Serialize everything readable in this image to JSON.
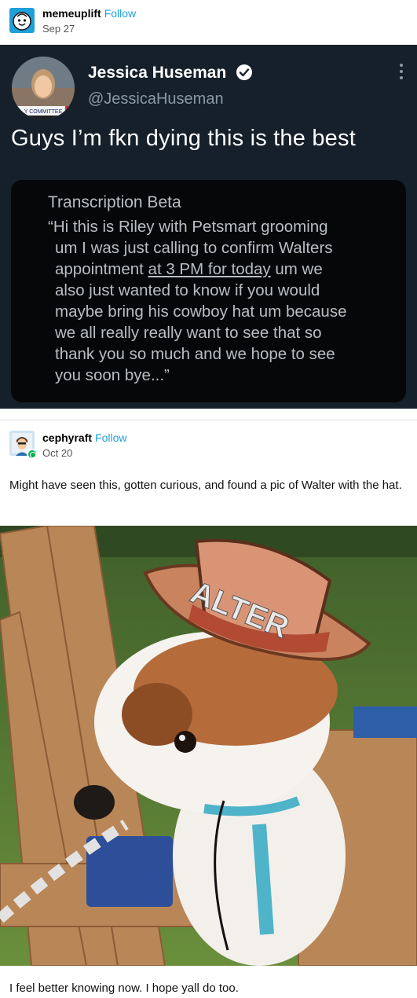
{
  "post1": {
    "username": "memeuplift",
    "follow_label": "Follow",
    "date": "Sep 27"
  },
  "tweet": {
    "name": "Jessica Huseman",
    "handle": "@JessicaHuseman",
    "avatar_banner": "Y COMMITTEE",
    "text": "Guys I’m fkn dying this is the best",
    "card_title": "Transcription Beta",
    "card_lines": [
      "“Hi this is Riley with Petsmart grooming",
      "um I was just calling to confirm Walters",
      "appointment",
      "at 3 PM for today",
      "um we",
      "also just wanted to know if you would",
      "maybe bring his cowboy hat um because",
      "we all really really want to see that so",
      "thank you so much and we hope to see",
      "you soon bye...”"
    ]
  },
  "post2": {
    "username": "cephyraft",
    "follow_label": "Follow",
    "date": "Oct 20",
    "caption": "Might have seen this, gotten curious, and found a pic of Walter with the hat.",
    "hat_text": "ALTER",
    "closing": "I feel better knowing now. I hope yall do too."
  },
  "colors": {
    "follow": "#1f9fe0",
    "tweet_bg": "#15202b",
    "card_bg": "#060708",
    "verified": "#ffffff"
  },
  "icons": [
    "tumblr-avatar-icon",
    "verified-badge-icon",
    "more-options-icon",
    "reblog-badge-icon"
  ]
}
